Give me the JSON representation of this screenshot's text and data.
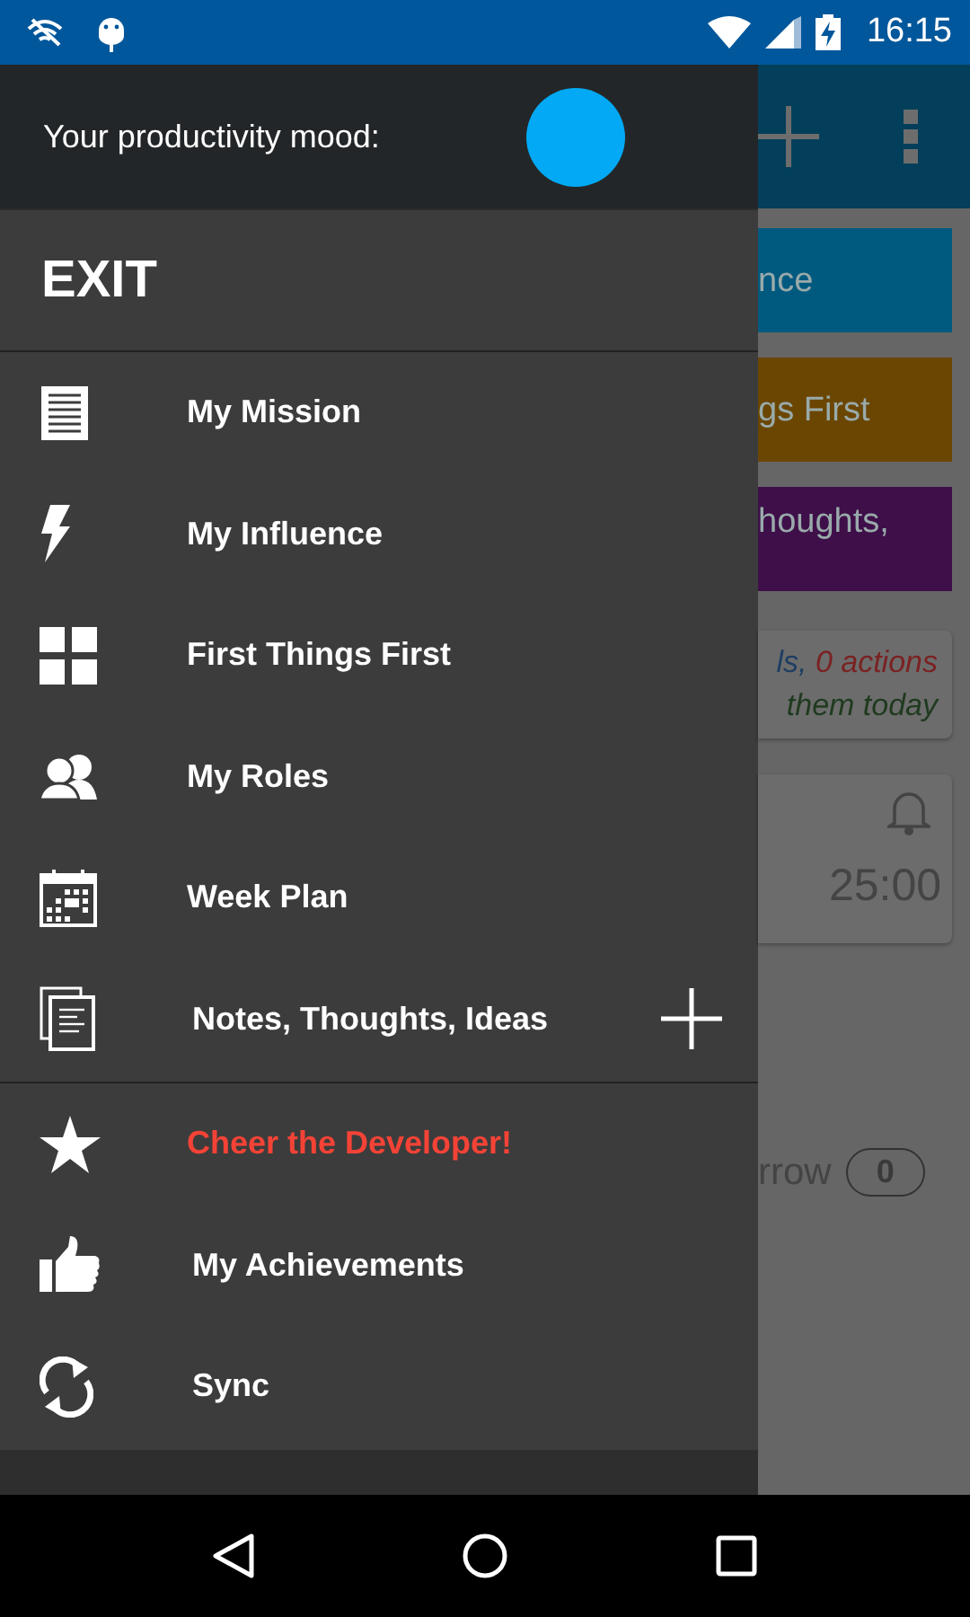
{
  "status_bar": {
    "time": "16:15"
  },
  "drawer": {
    "mood": {
      "label": "Your productivity mood:",
      "color": "#03a9f4"
    },
    "exit_label": "EXIT",
    "items": [
      {
        "label": "My Mission",
        "add_button": false
      },
      {
        "label": "My Influence",
        "add_button": false
      },
      {
        "label": "First Things First",
        "add_button": false
      },
      {
        "label": "My Roles",
        "add_button": false
      },
      {
        "label": "Week Plan",
        "add_button": false
      },
      {
        "label": "Notes, Thoughts, Ideas",
        "add_button": true
      }
    ],
    "secondary_items": [
      {
        "label": "Cheer the Developer!",
        "highlighted": true
      },
      {
        "label": "My Achievements",
        "highlighted": false
      },
      {
        "label": "Sync",
        "highlighted": false
      }
    ]
  },
  "background_screen": {
    "cards": [
      {
        "text": "nce",
        "color": "#005a80"
      },
      {
        "text": "gs First",
        "color": "#6b4600"
      },
      {
        "text": "houghts,",
        "color": "#3f0f4a"
      }
    ],
    "summary": {
      "line_1": "ls,",
      "line_1_count": "0 actions",
      "line_2": "them today"
    },
    "timer": "25:00",
    "counter_label": "rrow",
    "counter": "0"
  }
}
